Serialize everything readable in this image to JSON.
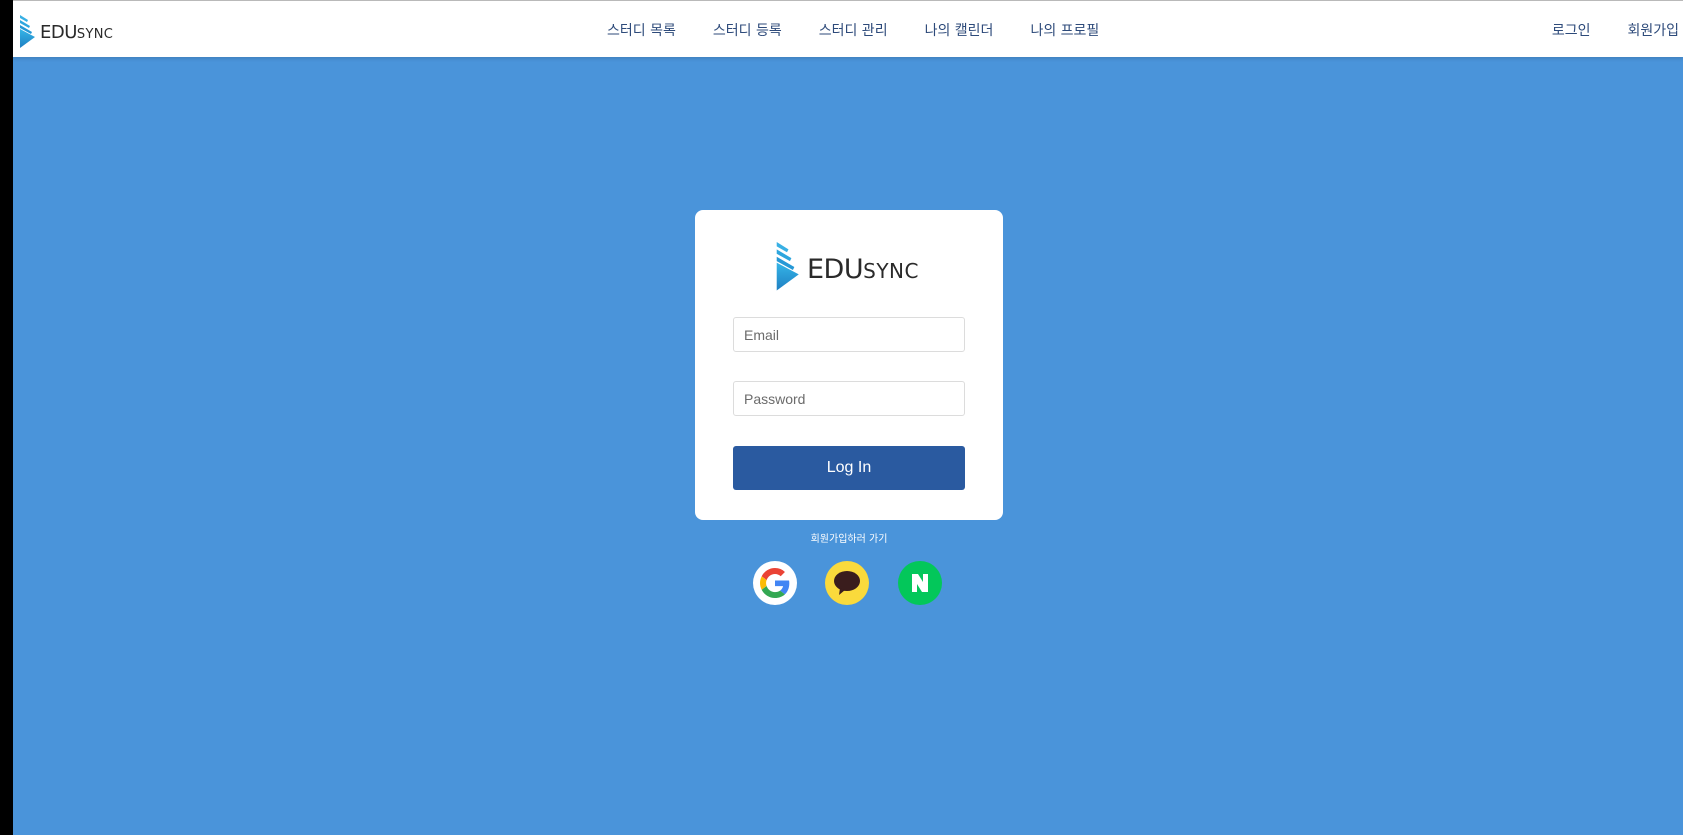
{
  "brand": {
    "name_big": "EDU",
    "name_small": "SYNC"
  },
  "nav": {
    "items": [
      {
        "label": "스터디 목록"
      },
      {
        "label": "스터디 등록"
      },
      {
        "label": "스터디 관리"
      },
      {
        "label": "나의 캘린더"
      },
      {
        "label": "나의 프로필"
      }
    ]
  },
  "auth": {
    "login_label": "로그인",
    "signup_label": "회원가입"
  },
  "login_card": {
    "email_placeholder": "Email",
    "password_placeholder": "Password",
    "submit_label": "Log In"
  },
  "signup_link": "회원가입하러 가기",
  "social": [
    {
      "icon": "google-icon"
    },
    {
      "icon": "kakao-icon"
    },
    {
      "icon": "naver-icon"
    }
  ],
  "colors": {
    "background": "#4a94da",
    "primary_button": "#2a5aa0",
    "nav_text": "#2d4a7a",
    "kakao": "#fada3c",
    "naver": "#03c75a"
  }
}
